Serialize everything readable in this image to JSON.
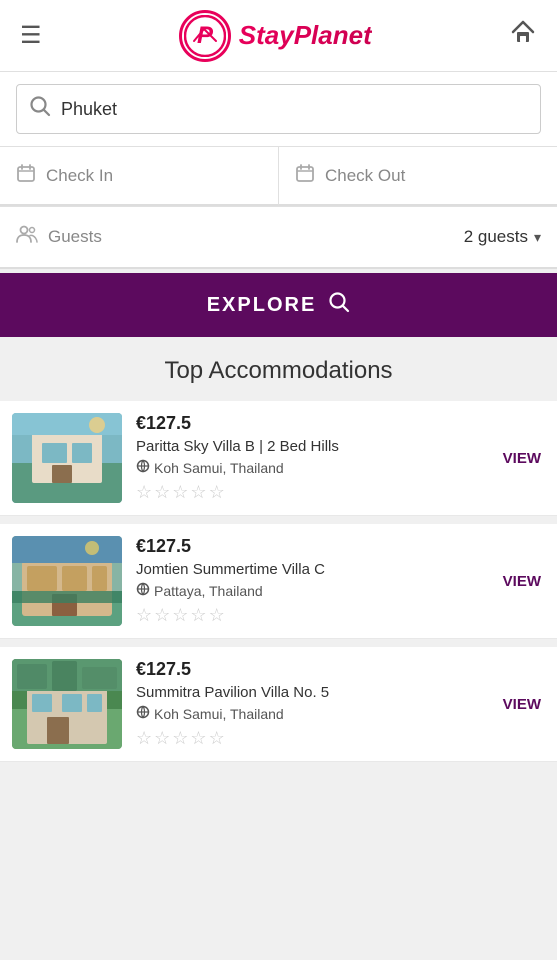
{
  "header": {
    "logo_text": "StayPlanet",
    "menu_icon": "☰",
    "home_icon": "⌂"
  },
  "search": {
    "placeholder": "Phuket",
    "value": "Phuket"
  },
  "checkin": {
    "label": "Check In",
    "icon": "📅"
  },
  "checkout": {
    "label": "Check Out",
    "icon": "📅"
  },
  "guests": {
    "label": "Guests",
    "value": "2 guests"
  },
  "explore_button": {
    "label": "EXPLORE"
  },
  "section_title": "Top Accommodations",
  "listings": [
    {
      "price": "€127.5",
      "name": "Paritta Sky Villa B | 2 Bed Hills",
      "location": "Koh Samui, Thailand",
      "stars": 0,
      "view_label": "VIEW"
    },
    {
      "price": "€127.5",
      "name": "Jomtien Summertime Villa C",
      "location": "Pattaya, Thailand",
      "stars": 0,
      "view_label": "VIEW"
    },
    {
      "price": "€127.5",
      "name": "Summitra Pavilion Villa No. 5",
      "location": "Koh Samui, Thailand",
      "stars": 0,
      "view_label": "VIEW"
    }
  ]
}
